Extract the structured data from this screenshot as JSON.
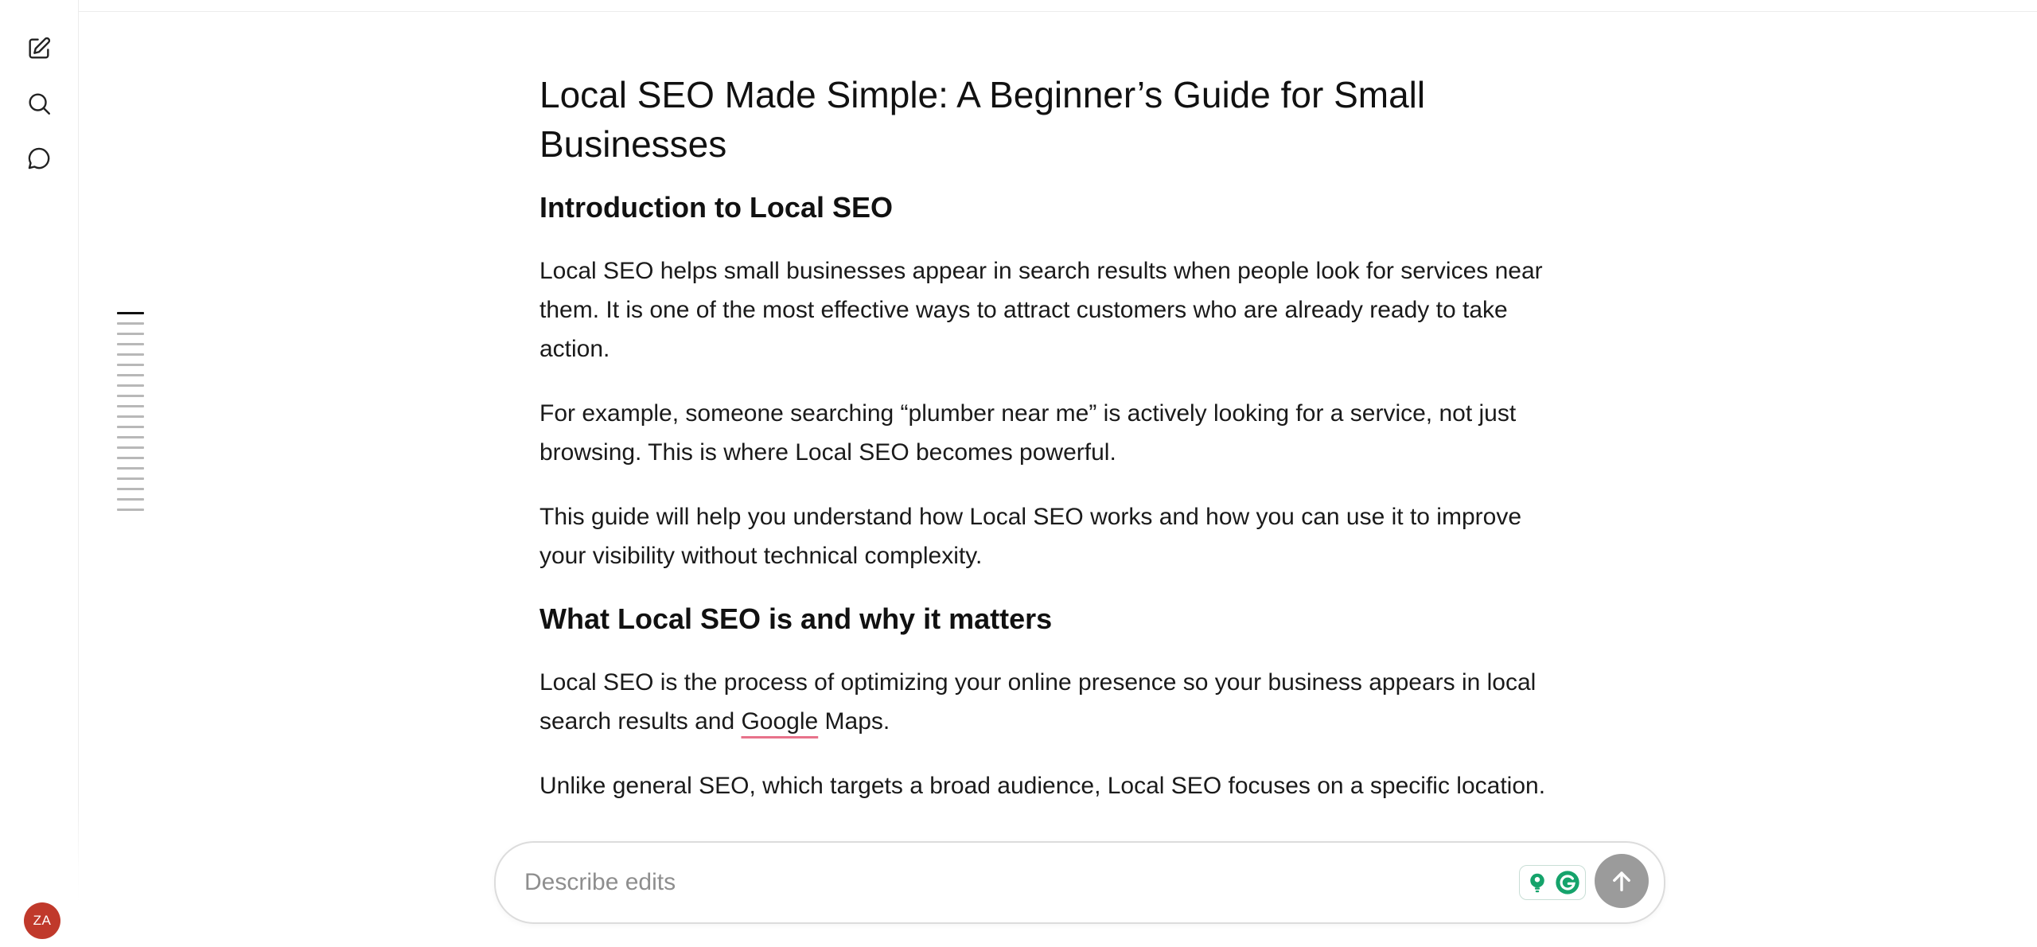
{
  "rail": {
    "avatar_initials": "ZA"
  },
  "outline": {
    "tick_count": 20,
    "active_index": 0
  },
  "document": {
    "title": "Local SEO Made Simple: A Beginner’s Guide for Small Businesses",
    "sections": [
      {
        "heading": "Introduction to Local SEO",
        "paragraphs": [
          "Local SEO helps small businesses appear in search results when people look for services near them. It is one of the most effective ways to attract customers who are already ready to take action.",
          "For example, someone searching “plumber near me” is actively looking for a service, not just browsing. This is where Local SEO becomes powerful.",
          "This guide will help you understand how Local SEO works and how you can use it to improve your visibility without technical complexity."
        ]
      },
      {
        "heading": "What Local SEO is and why it matters",
        "p1_before": "Local SEO is the process of optimizing your online presence so your business appears in local search results and ",
        "p1_flagged": "Google",
        "p1_after": " Maps.",
        "p2": "Unlike general SEO, which targets a broad audience, Local SEO focuses on a specific location."
      }
    ]
  },
  "editbar": {
    "placeholder": "Describe edits",
    "value": ""
  },
  "colors": {
    "avatar": "#c0392b",
    "send_button": "#9b9b9b",
    "spell_underline": "#e8728a",
    "grammarly_green": "#15a36b"
  }
}
